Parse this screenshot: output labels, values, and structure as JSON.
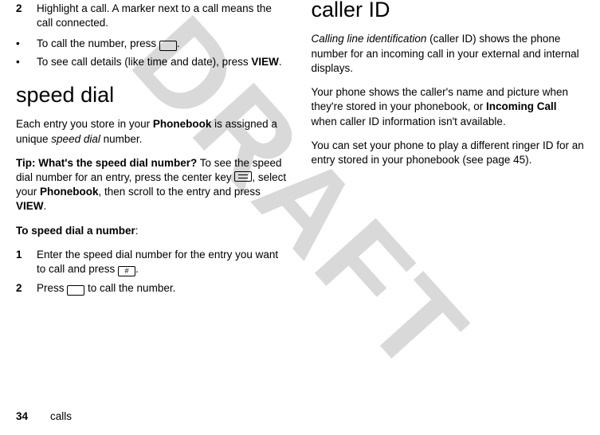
{
  "watermark": "DRAFT",
  "left": {
    "step2_num": "2",
    "step2_text_a": "Highlight a call. A marker next to a call means the call connected.",
    "bullet1_a": "To call the number, press ",
    "bullet1_b": ".",
    "bullet2_a": "To see call details (like time and date), press ",
    "bullet2_view": "VIEW",
    "bullet2_b": ".",
    "heading": "speed dial",
    "para1_a": "Each entry you store in your ",
    "para1_pb": "Phonebook",
    "para1_b": " is assigned a unique ",
    "para1_sd": "speed dial",
    "para1_c": " number.",
    "tip_lead": "Tip: What's the speed dial number?",
    "tip_a": " To see the speed dial number for an entry, press the center key ",
    "tip_b": ", select your ",
    "tip_pb": "Phonebook",
    "tip_c": ", then scroll to the entry and press ",
    "tip_view": "VIEW",
    "tip_d": ".",
    "tospeed": "To speed dial a number",
    "colon": ":",
    "s1_num": "1",
    "s1_a": "Enter the speed dial number for the entry you want to call and press ",
    "s1_key": "#",
    "s1_b": ".",
    "s2_num": "2",
    "s2_a": "Press ",
    "s2_b": " to call the number."
  },
  "right": {
    "heading": "caller ID",
    "p1_lead": "Calling line identification",
    "p1_a": " (caller ID) shows the phone number for an incoming call in your external and internal displays.",
    "p2_a": "Your phone shows the caller's name and picture when they're stored in your phonebook, or ",
    "p2_ic": "Incoming Call",
    "p2_b": " when caller ID information isn't available.",
    "p3": "You can set your phone to play a different ringer ID for an entry stored in your phonebook (see page 45)."
  },
  "footer": {
    "page": "34",
    "section": "calls"
  }
}
